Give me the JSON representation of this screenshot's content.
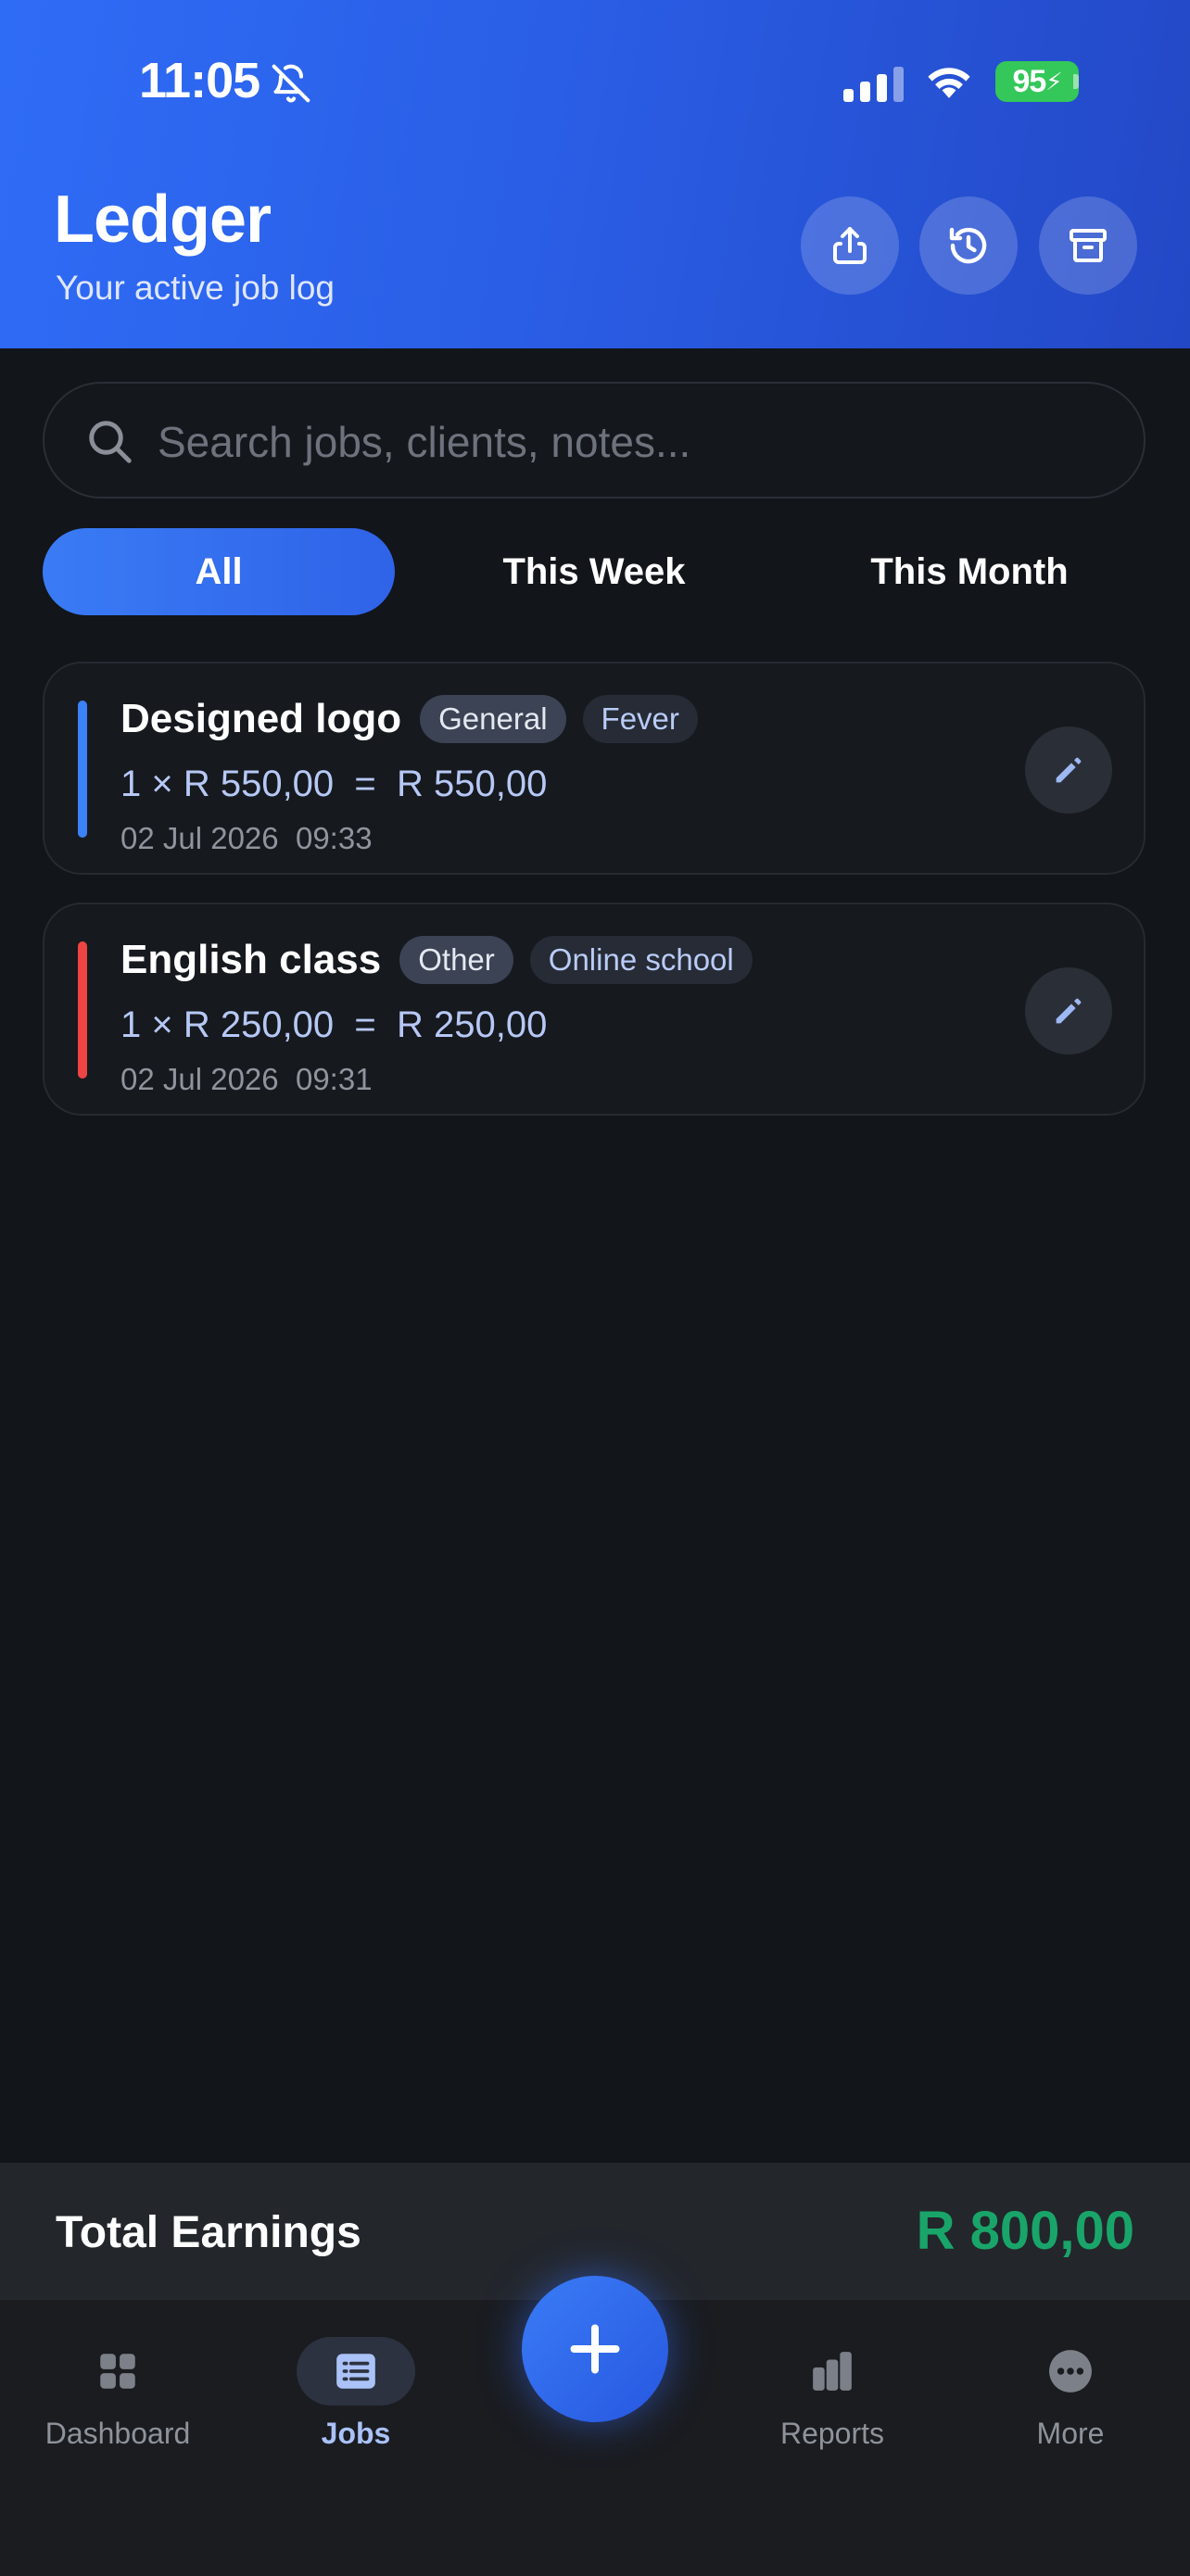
{
  "status_bar": {
    "time": "11:05",
    "battery": "95"
  },
  "header": {
    "title": "Ledger",
    "subtitle": "Your active job log",
    "actions": [
      "share-icon",
      "history-icon",
      "archive-icon"
    ]
  },
  "search": {
    "placeholder": "Search jobs, clients, notes...",
    "value": ""
  },
  "filters": {
    "tabs": [
      "All",
      "This Week",
      "This Month"
    ],
    "selected": "All"
  },
  "jobs": [
    {
      "title": "Designed logo",
      "category": "General",
      "client": "Fever",
      "amount": "1 × R 550,00  =  R 550,00",
      "date": "02 Jul 2026  09:33",
      "accent": "#3b82f6"
    },
    {
      "title": "English class",
      "category": "Other",
      "client": "Online school",
      "amount": "1 × R 250,00  =  R 250,00",
      "date": "02 Jul 2026  09:31",
      "accent": "#ef4444"
    }
  ],
  "summary": {
    "label": "Total Earnings",
    "value": "R 800,00",
    "value_color": "#19a56a"
  },
  "nav": {
    "items": [
      {
        "label": "Dashboard",
        "icon": "dashboard-icon"
      },
      {
        "label": "Jobs",
        "icon": "list-icon"
      },
      {
        "label": "Reports",
        "icon": "bar-chart-icon"
      },
      {
        "label": "More",
        "icon": "more-icon"
      }
    ],
    "selected": "Jobs",
    "fab_icon": "plus-icon"
  },
  "colors": {
    "header_start": "#2f6cf6",
    "header_end": "#2348c6",
    "background": "#12151a",
    "accent": "#3a7bf5"
  }
}
